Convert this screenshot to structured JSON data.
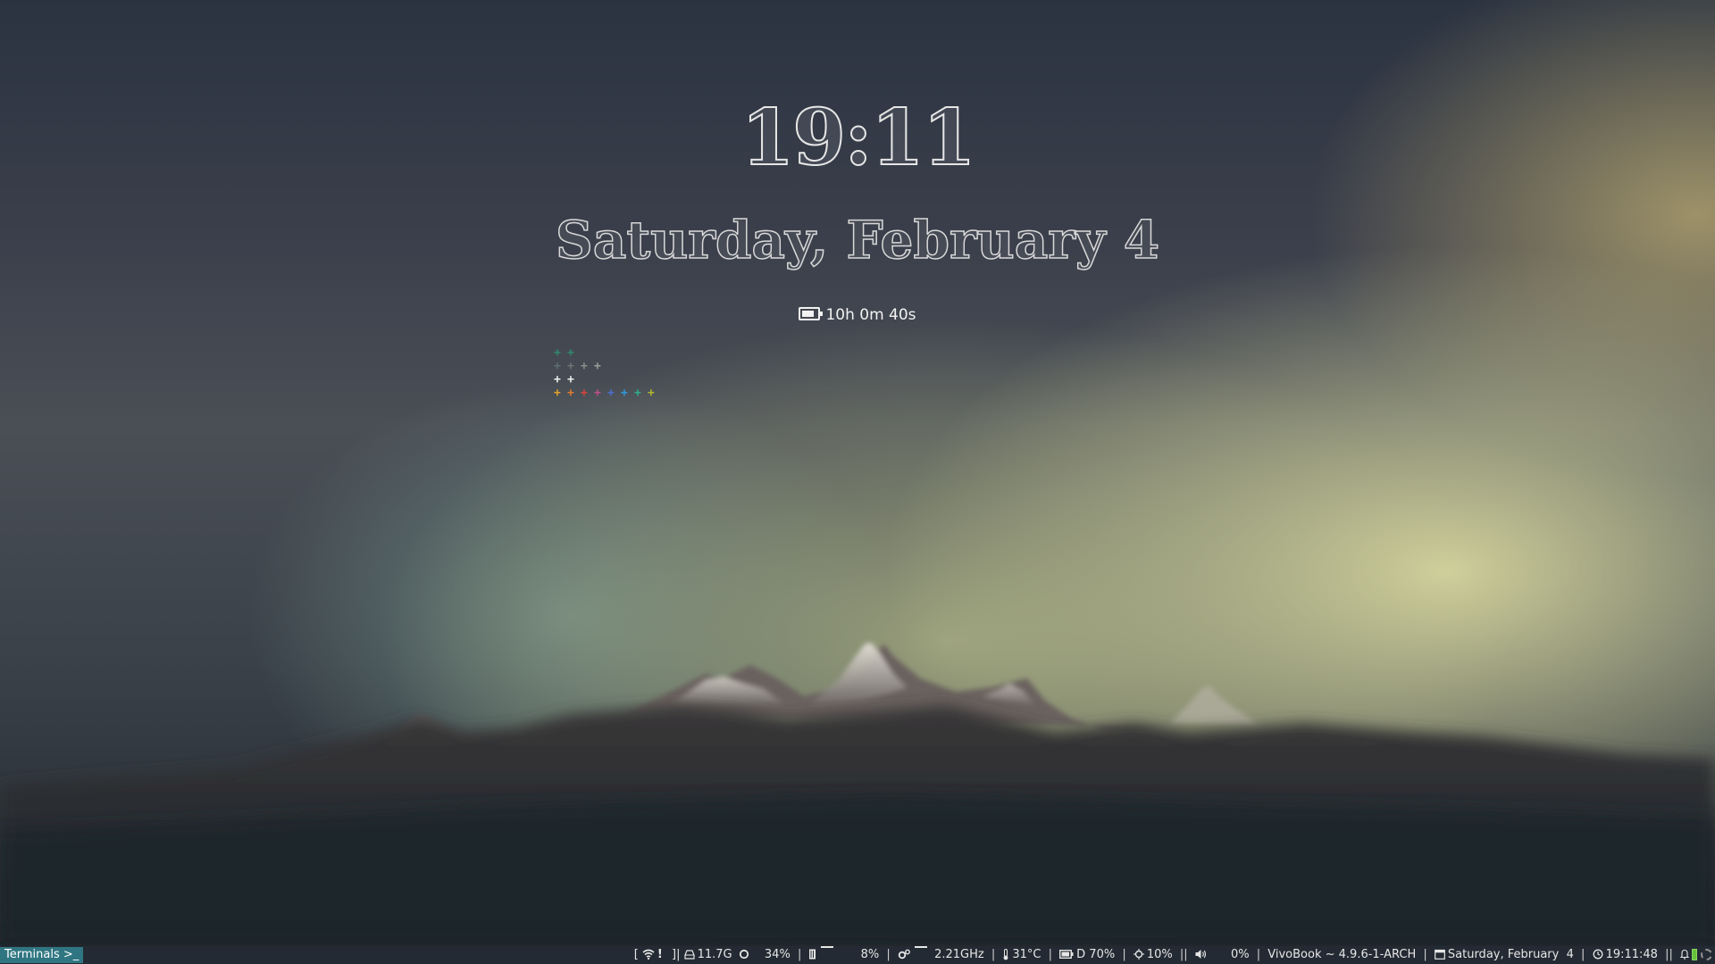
{
  "desktop": {
    "clock_time": "19:11",
    "clock_date": "Saturday, February  4",
    "battery_remaining": "10h 0m 40s",
    "plus_grid": {
      "symbol": "+",
      "rows": [
        [
          "#2f8a6c",
          "#2f8a6c"
        ],
        [
          "#5e6f72",
          "#6d7775",
          "#8a8f8c",
          "#9a9e98"
        ],
        [
          "#f0f0f0",
          "#f0f0f0"
        ],
        [
          "#e0a22c",
          "#e07a2c",
          "#d9443c",
          "#c04d8a",
          "#4d6fd0",
          "#2d9ad9",
          "#2fae88",
          "#b0b82e"
        ]
      ]
    }
  },
  "taskbar": {
    "task_button": "Terminals >_"
  },
  "status_bar": {
    "open_bracket": "[",
    "wifi_icon": "wifi-icon",
    "wifi_alert": "!",
    "close_bracket": "]|",
    "storage_icon": "hdd-icon",
    "storage": "11.7G",
    "cpu_icon": "cpu-ring-icon",
    "cpu": "34%",
    "sep1": "|",
    "mem_icon": "memory-icon",
    "mem": "8%",
    "sep2": "|",
    "freq_icon": "cogs-icon",
    "freq": "2.21GHz",
    "sep3": "|",
    "temp_icon": "thermometer-icon",
    "temp": "31°C",
    "sep4": "|",
    "battery_icon": "battery-icon",
    "battery": "D 70%",
    "sep5": "|",
    "brightness_icon": "brightness-icon",
    "brightness": "10%",
    "sep6": "||",
    "volume_icon": "volume-icon",
    "volume": "0%",
    "sep7": "|",
    "kernel": "VivoBook ~ 4.9.6-1-ARCH",
    "sep8": "|",
    "calendar_icon": "calendar-icon",
    "date": "Saturday, February  4",
    "sep9": "|",
    "clock_icon": "clock-icon",
    "time": "19:11:48",
    "sep10": "||"
  },
  "colors": {
    "panel_bg": "#232a33",
    "task_button_bg": "#2f7682",
    "tray_battery": "#67c23a"
  }
}
